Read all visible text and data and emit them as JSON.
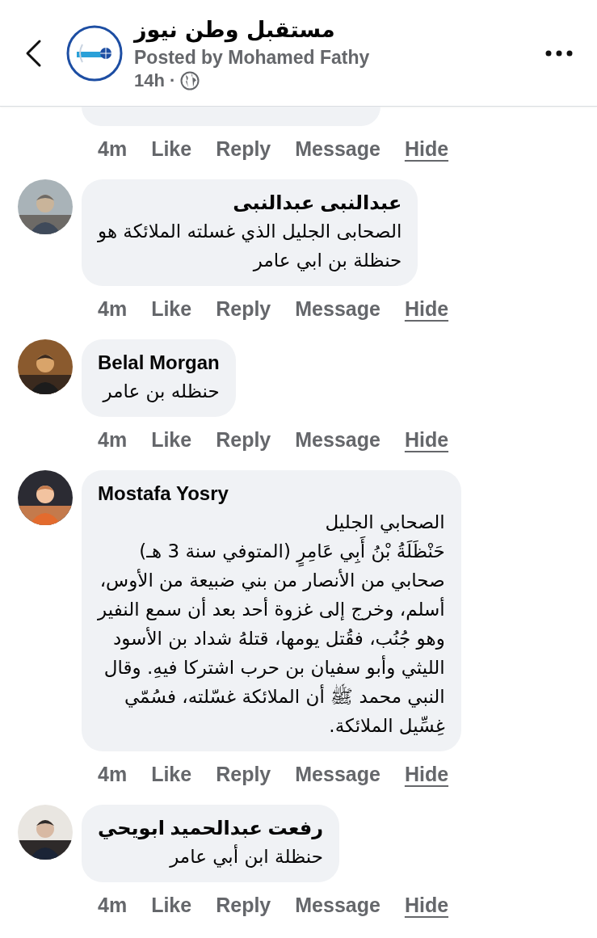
{
  "header": {
    "page_name": "مستقبل وطن نيوز",
    "posted_by": "Posted by Mohamed Fathy",
    "time": "14h",
    "separator": "·"
  },
  "comments": [
    {
      "kind": "partial",
      "time": "4m",
      "like": "Like",
      "reply": "Reply",
      "message": "Message",
      "hide": "Hide"
    },
    {
      "kind": "comment",
      "author": "عبدالنبى عبدالنبى",
      "text": "الصحابى الجليل الذي غسلته الملائكة هو\nحنظلة بن ابي عامر",
      "time": "4m",
      "like": "Like",
      "reply": "Reply",
      "message": "Message",
      "hide": "Hide"
    },
    {
      "kind": "comment",
      "author": "Belal Morgan",
      "text": "حنظله بن عامر",
      "time": "4m",
      "like": "Like",
      "reply": "Reply",
      "message": "Message",
      "hide": "Hide"
    },
    {
      "kind": "comment",
      "author": "Mostafa Yosry",
      "text": "الصحابي الجليل\nحَنْظَلَةُ بْنُ أَبِي عَامِرٍ (المتوفي سنة 3 هـ)\nصحابي من الأنصار من بني ضبيعة من الأوس،\nأسلم، وخرج إلى غزوة أحد بعد أن سمع النفير\nوهو جُنُب، فقُتل يومها، قتلهُ شداد بن الأسود\nالليثي وأبو سفيان بن حرب اشتركا فيهِ. وقال\nالنبي محمد ﷺ أن الملائكة غسّلته، فسُمّي\nغِسِّيل الملائكة.",
      "time": "4m",
      "like": "Like",
      "reply": "Reply",
      "message": "Message",
      "hide": "Hide"
    },
    {
      "kind": "comment",
      "author": "رفعت عبدالحميد ابويحي",
      "text": "حنظلة ابن أبي عامر",
      "time": "4m",
      "like": "Like",
      "reply": "Reply",
      "message": "Message",
      "hide": "Hide"
    }
  ]
}
